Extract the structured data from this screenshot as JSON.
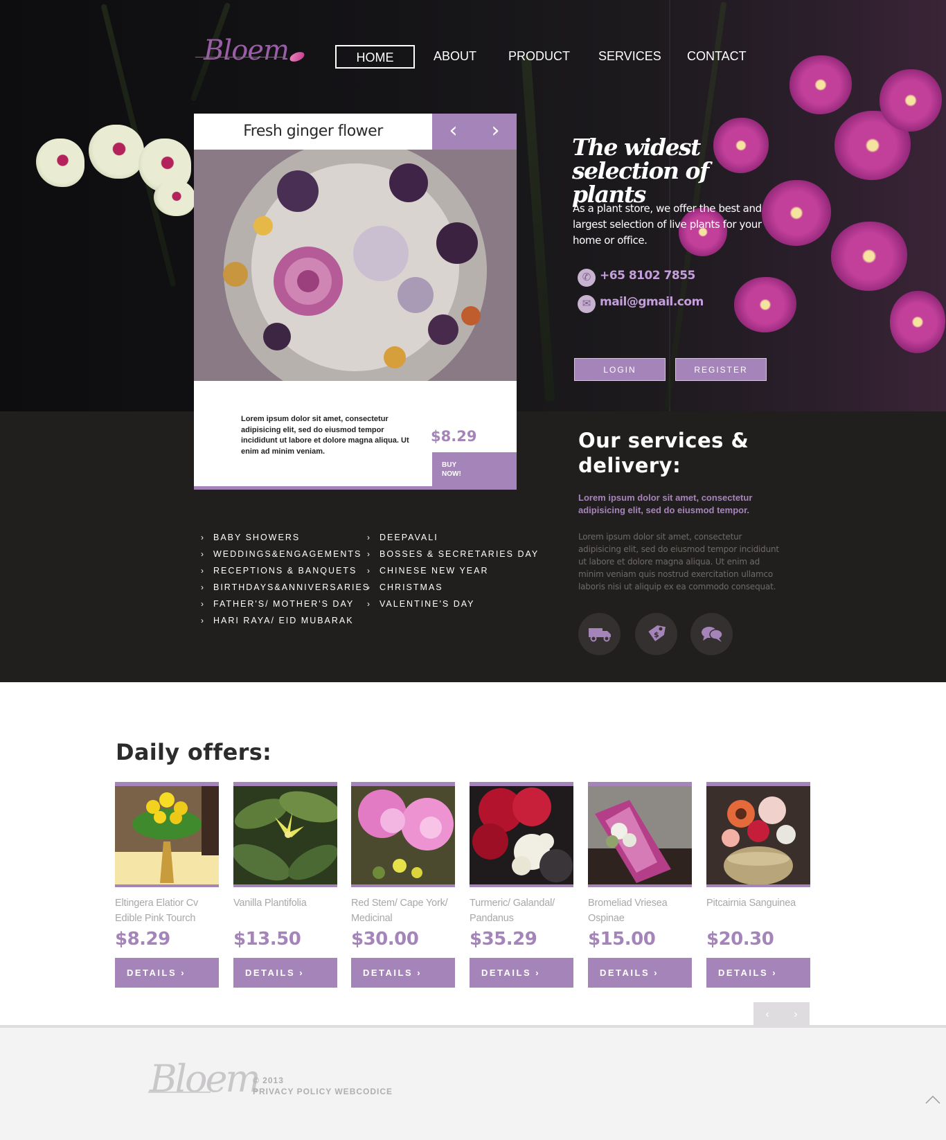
{
  "brand": {
    "logo_text": "Bloem",
    "accent": "#a585b9"
  },
  "nav": {
    "items": [
      {
        "label": "HOME",
        "active": true
      },
      {
        "label": "ABOUT",
        "active": false
      },
      {
        "label": "PRODUCT",
        "active": false
      },
      {
        "label": "SERVICES",
        "active": false
      },
      {
        "label": "CONTACT",
        "active": false
      }
    ]
  },
  "featured": {
    "title": "Fresh ginger flower",
    "prev_icon": "chevron-left-icon",
    "next_icon": "chevron-right-icon",
    "description": "Lorem ipsum dolor sit amet, consectetur adipisicing elit, sed do eiusmod tempor incididunt ut labore et dolore magna aliqua. Ut enim ad minim veniam.",
    "price": "$8.29",
    "buy_label_1": "BUY",
    "buy_label_2": "NOW!"
  },
  "hero": {
    "tagline_1": "The widest",
    "tagline_2": "selection of plants",
    "description": "As a plant store, we offer the best and largest selection of live plants for your home or office.",
    "phone": "+65 8102 7855",
    "phone_icon": "phone-icon",
    "email": "mail@gmail.com",
    "email_icon": "envelope-icon",
    "login_label": "LOGIN",
    "register_label": "REGISTER"
  },
  "services": {
    "col1": [
      "BABY SHOWERS",
      "WEDDINGS&ENGAGEMENTS",
      "RECEPTIONS & BANQUETS",
      "BIRTHDAYS&ANNIVERSARIES",
      "FATHER'S/ MOTHER'S DAY",
      "HARI RAYA/ EID MUBARAK"
    ],
    "col2": [
      "DEEPAVALI",
      "BOSSES & SECRETARIES DAY",
      "CHINESE NEW YEAR",
      "CHRISTMAS",
      "VALENTINE'S DAY"
    ],
    "heading": "Our services & delivery:",
    "lead": "Lorem ipsum dolor sit amet, consectetur adipisicing elit, sed do eiusmod tempor.",
    "body": "Lorem ipsum dolor sit amet, consectetur adipisicing elit, sed do eiusmod tempor incididunt ut labore et dolore magna aliqua. Ut enim ad minim veniam quis nostrud exercitation ullamco laboris nisi ut aliquip ex ea commodo consequat.",
    "icons": [
      "truck-icon",
      "price-tag-icon",
      "chat-bubbles-icon"
    ]
  },
  "offers": {
    "title": "Daily offers:",
    "details_label": "DETAILS",
    "items": [
      {
        "name": "Eltingera Elatior Cv Edible Pink Tourch",
        "price": "$8.29"
      },
      {
        "name": "Vanilla Plantifolia",
        "price": "$13.50"
      },
      {
        "name": "Red Stem/ Cape York/ Medicinal",
        "price": "$30.00"
      },
      {
        "name": "Turmeric/ Galandal/ Pandanus",
        "price": "$35.29"
      },
      {
        "name": "Bromeliad Vriesea Ospinae",
        "price": "$15.00"
      },
      {
        "name": "Pitcairnia Sanguinea",
        "price": "$20.30"
      }
    ],
    "pager_prev": "‹",
    "pager_next": "›"
  },
  "footer": {
    "logo_text": "Bloem",
    "copyright": "© 2013",
    "links": "PRIVACY POLICY WEBCODICE",
    "scroll_top_icon": "arrow-up-icon"
  }
}
